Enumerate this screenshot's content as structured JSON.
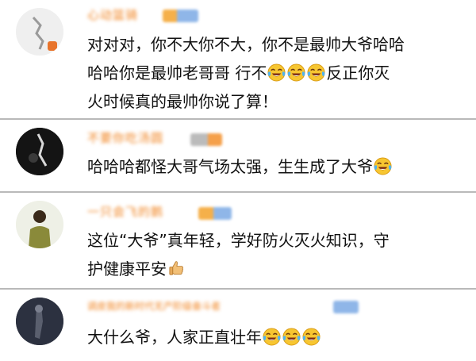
{
  "colors": {
    "username": "#f0821e",
    "badge": "#8fb6e8",
    "divider": "#b9b9b9",
    "text": "#111111"
  },
  "comments": [
    {
      "username": "心动篮骑",
      "lines": [
        "对对对，你不大你不大，你不是最帅大爷哈哈",
        "哈哈你是最帅老哥哥 行不",
        "反正你灭",
        "火时候真的最帅你说了算！"
      ],
      "emojis": [
        "laugh-cry-emoji",
        "laugh-cry-emoji",
        "laugh-cry-emoji"
      ]
    },
    {
      "username": "不要你吃汤圆",
      "lines": [
        "哈哈哈都怪大哥气场太强，生生成了大爷"
      ],
      "emojis": [
        "laugh-cry-emoji"
      ]
    },
    {
      "username": "一只会飞的鹅",
      "lines": [
        "这位“大爷”真年轻，学好防火灭火知识，守",
        "护健康平安"
      ],
      "emojis": [
        "thumbs-up-emoji"
      ]
    },
    {
      "username": "调皮我的新时代无产阶级奋斗者",
      "lines": [
        "大什么爷，人家正直壮年"
      ],
      "emojis": [
        "laugh-cry-emoji",
        "laugh-cry-emoji",
        "laugh-cry-emoji"
      ]
    }
  ]
}
